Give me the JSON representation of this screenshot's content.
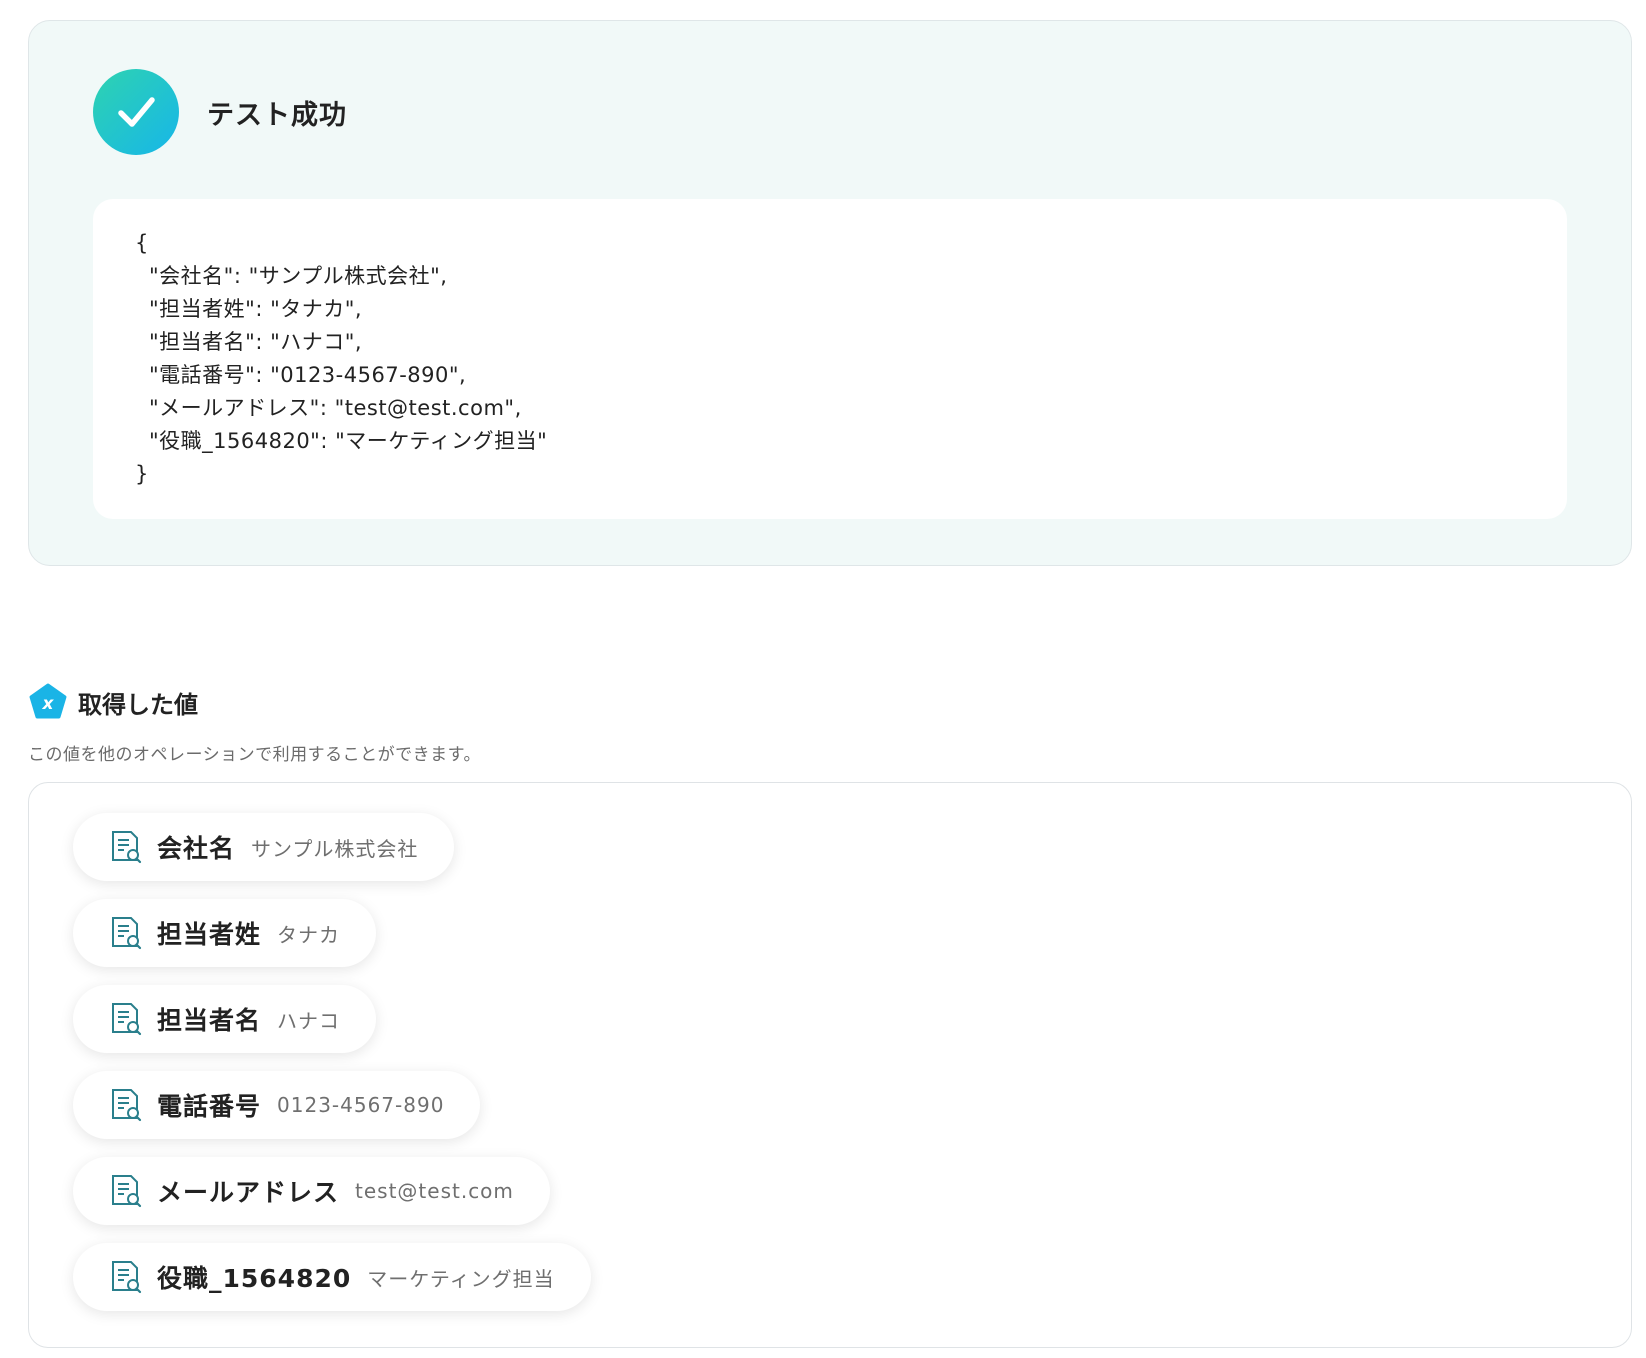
{
  "success": {
    "title": "テスト成功",
    "icon": "check-icon",
    "accent_gradient": [
      "#2ed3b0",
      "#17b6e9"
    ],
    "json_lines": [
      "{",
      "\"会社名\": \"サンプル株式会社\",",
      "\"担当者姓\": \"タナカ\",",
      "\"担当者名\": \"ハナコ\",",
      "\"電話番号\": \"0123-4567-890\",",
      "\"メールアドレス\": \"test@test.com\",",
      "\"役職_1564820\": \"マーケティング担当\"",
      "}"
    ]
  },
  "values": {
    "title": "取得した値",
    "icon": "variable-icon",
    "description": "この値を他のオペレーションで利用することができます。",
    "items": [
      {
        "label": "会社名",
        "value": "サンプル株式会社"
      },
      {
        "label": "担当者姓",
        "value": "タナカ"
      },
      {
        "label": "担当者名",
        "value": "ハナコ"
      },
      {
        "label": "電話番号",
        "value": "0123-4567-890"
      },
      {
        "label": "メールアドレス",
        "value": "test@test.com"
      },
      {
        "label": "役職_1564820",
        "value": "マーケティング担当"
      }
    ],
    "item_icon": "document-search-icon",
    "icon_color": "#2a7f8c"
  }
}
